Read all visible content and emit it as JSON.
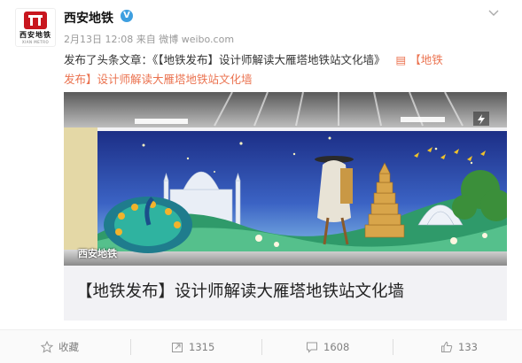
{
  "account": {
    "name": "西安地铁",
    "logo_text": "西安地铁",
    "logo_subtext": "XIAN METRO",
    "verified_icon": "verified-badge-icon",
    "date": "2月13日 12:08",
    "source_prefix": "来自",
    "source": "微博 weibo.com"
  },
  "post": {
    "text": "发布了头条文章：《【地铁发布】设计师解读大雁塔地铁站文化墙》",
    "link_icon": "article-icon",
    "link_line1": "【地铁",
    "link_line2": "发布】设计师解读大雁塔地铁站文化墙"
  },
  "article_card": {
    "image_watermark": "西安地铁",
    "title": "【地铁发布】设计师解读大雁塔地铁站文化墙"
  },
  "actions": {
    "favorite_label": "收藏",
    "repost_count": "1315",
    "comment_count": "1608",
    "like_count": "133"
  },
  "colors": {
    "link": "#eb7350",
    "brand_red": "#c8161e",
    "verified": "#3e9fe0",
    "action_text": "#808080"
  }
}
